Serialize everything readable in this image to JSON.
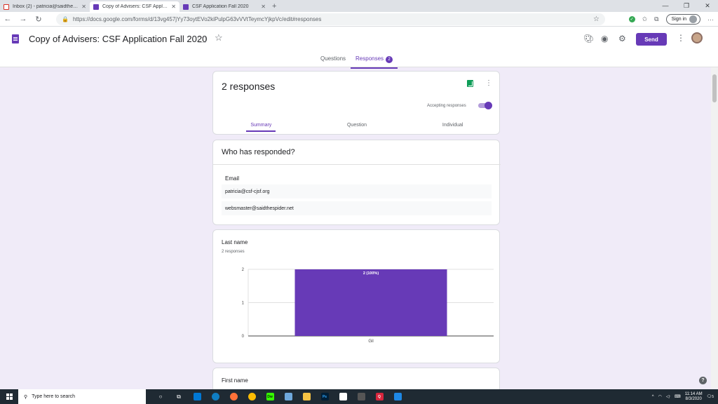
{
  "browser": {
    "tabs": [
      {
        "title": "Inbox (2) - patricia@saidthespid",
        "favicon": "gmail-icon",
        "active": false
      },
      {
        "title": "Copy of Advisers: CSF Applicatio",
        "favicon": "forms-icon",
        "active": true
      },
      {
        "title": "CSF Application Fall 2020",
        "favicon": "forms-icon",
        "active": false
      }
    ],
    "url": "https://docs.google.com/forms/d/13vg457jYy73oytEVo2kiPulpG63vVVtTeymcYjkpVc/edit#responses",
    "signin_label": "Sign in"
  },
  "header": {
    "title": "Copy of Advisers: CSF Application Fall 2020",
    "send_label": "Send",
    "tabs": [
      {
        "label": "Questions"
      },
      {
        "label": "Responses",
        "badge": "2"
      }
    ]
  },
  "summary_card": {
    "count_label": "2 responses",
    "accepting_label": "Accepting responses",
    "accepting": true,
    "subtabs": [
      "Summary",
      "Question",
      "Individual"
    ]
  },
  "responders": {
    "title": "Who has responded?",
    "field_label": "Email",
    "emails": [
      "patricia@csf-cjsf.org",
      "websmaster@saidthespider.net"
    ]
  },
  "question_last_name": {
    "title": "Last name",
    "subtitle": "2 responses"
  },
  "question_first_name": {
    "title": "First name"
  },
  "chart_data": {
    "type": "bar",
    "categories": [
      "Gil"
    ],
    "values": [
      2
    ],
    "data_labels": [
      "2 (100%)"
    ],
    "yticks": [
      "0",
      "1",
      "2"
    ],
    "ylim": [
      0,
      2
    ],
    "color": "#673ab7",
    "grid": true
  },
  "taskbar": {
    "search_placeholder": "Type here to search",
    "time": "11:14 AM",
    "date": "8/3/2020",
    "notification_count": "5"
  },
  "colors": {
    "accent": "#673ab7",
    "background": "#f0ebf8"
  }
}
